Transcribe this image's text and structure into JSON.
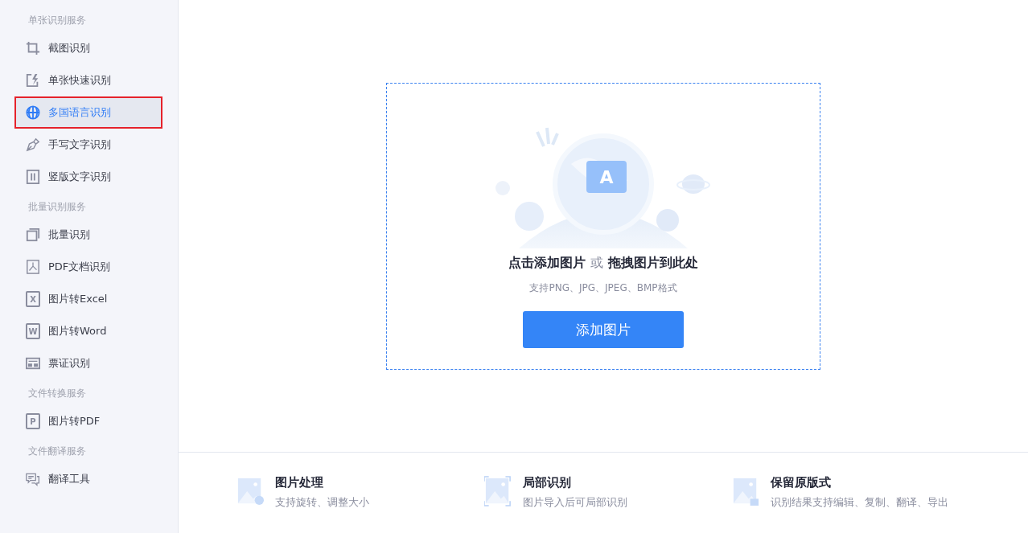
{
  "sidebar": {
    "sections": [
      {
        "heading": "单张识别服务",
        "items": [
          {
            "label": "截图识别",
            "kind": "crop",
            "selected": false
          },
          {
            "label": "单张快速识别",
            "kind": "flash",
            "selected": false
          },
          {
            "label": "多国语言识别",
            "kind": "globe",
            "selected": true
          },
          {
            "label": "手写文字识别",
            "kind": "pen",
            "selected": false
          },
          {
            "label": "竖版文字识别",
            "kind": "vertical",
            "selected": false
          }
        ]
      },
      {
        "heading": "批量识别服务",
        "items": [
          {
            "label": "批量识别",
            "kind": "stack",
            "selected": false
          },
          {
            "label": "PDF文档识别",
            "kind": "pdf",
            "selected": false
          },
          {
            "label": "图片转Excel",
            "kind": "letter",
            "icon_letter": "X",
            "selected": false
          },
          {
            "label": "图片转Word",
            "kind": "letter",
            "icon_letter": "W",
            "selected": false
          },
          {
            "label": "票证识别",
            "kind": "ticket",
            "selected": false
          }
        ]
      },
      {
        "heading": "文件转换服务",
        "items": [
          {
            "label": "图片转PDF",
            "kind": "letter",
            "icon_letter": "P",
            "selected": false
          }
        ]
      },
      {
        "heading": "文件翻译服务",
        "items": [
          {
            "label": "翻译工具",
            "kind": "chat",
            "selected": false
          }
        ]
      }
    ]
  },
  "upload": {
    "badge_letter": "A",
    "headline": [
      {
        "text": "点击添加图片",
        "kind": "strong"
      },
      {
        "text": "或",
        "kind": "muted"
      },
      {
        "text": "拖拽图片到此处",
        "kind": "strong"
      }
    ],
    "hint": "支持PNG、JPG、JPEG、BMP格式",
    "button": "添加图片"
  },
  "features": [
    {
      "kind": "rotate",
      "title": "图片处理",
      "description": "支持旋转、调整大小"
    },
    {
      "kind": "frame",
      "title": "局部识别",
      "description": "图片导入后可局部识别"
    },
    {
      "kind": "lock",
      "title": "保留原版式",
      "description": "识别结果支持编辑、复制、翻译、导出"
    }
  ]
}
